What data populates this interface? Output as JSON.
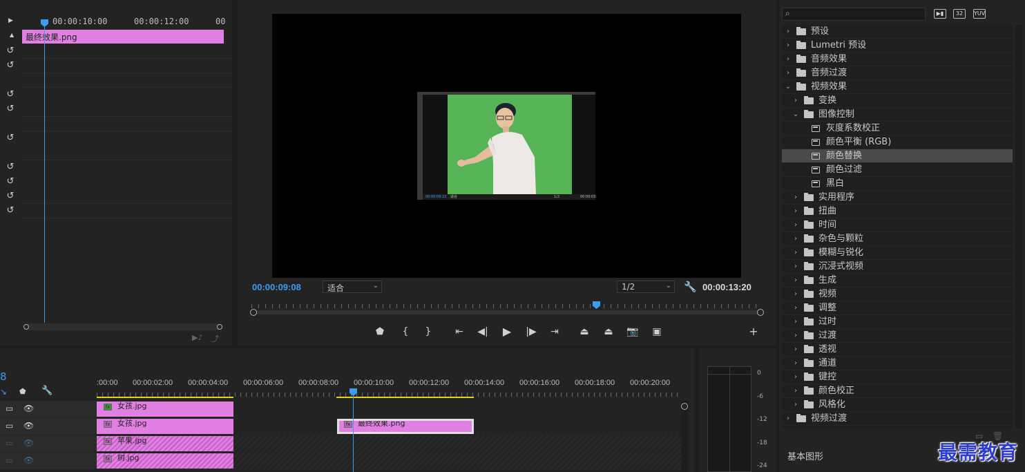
{
  "effect_controls": {
    "ruler_ticks": [
      "00:00:10:00",
      "00:00:12:00",
      "00"
    ],
    "clip_name": "最终效果.png",
    "reset_icon": "reset-icon"
  },
  "program_monitor": {
    "current_timecode": "00:00:09:08",
    "fit_label": "适合",
    "resolution_label": "1/2",
    "duration_timecode": "00:00:13:20",
    "pip_timecode": "00:00:09:22",
    "pip_fit": "适合",
    "pip_res": "1/2",
    "pip_duration": "00:00:03:",
    "buttons": [
      "add-marker",
      "mark-in",
      "mark-out",
      "go-to-in",
      "step-back",
      "play",
      "step-forward",
      "go-to-out",
      "lift",
      "extract",
      "export-frame",
      "comparison-view",
      "add-button"
    ]
  },
  "effects_panel": {
    "search_placeholder": "",
    "badges": [
      "32",
      "YUV"
    ],
    "items": [
      {
        "label": "预设",
        "level": 0,
        "type": "folder",
        "open": false
      },
      {
        "label": "Lumetri 预设",
        "level": 0,
        "type": "folder",
        "open": false
      },
      {
        "label": "音频效果",
        "level": 0,
        "type": "folder",
        "open": false
      },
      {
        "label": "音频过渡",
        "level": 0,
        "type": "folder",
        "open": false
      },
      {
        "label": "视频效果",
        "level": 0,
        "type": "folder",
        "open": true
      },
      {
        "label": "变换",
        "level": 1,
        "type": "folder",
        "open": false
      },
      {
        "label": "图像控制",
        "level": 1,
        "type": "folder",
        "open": true
      },
      {
        "label": "灰度系数校正",
        "level": 2,
        "type": "effect"
      },
      {
        "label": "颜色平衡 (RGB)",
        "level": 2,
        "type": "effect"
      },
      {
        "label": "颜色替换",
        "level": 2,
        "type": "effect",
        "selected": true
      },
      {
        "label": "颜色过滤",
        "level": 2,
        "type": "effect"
      },
      {
        "label": "黑白",
        "level": 2,
        "type": "effect"
      },
      {
        "label": "实用程序",
        "level": 1,
        "type": "folder",
        "open": false
      },
      {
        "label": "扭曲",
        "level": 1,
        "type": "folder",
        "open": false
      },
      {
        "label": "时间",
        "level": 1,
        "type": "folder",
        "open": false
      },
      {
        "label": "杂色与颗粒",
        "level": 1,
        "type": "folder",
        "open": false
      },
      {
        "label": "模糊与锐化",
        "level": 1,
        "type": "folder",
        "open": false
      },
      {
        "label": "沉浸式视频",
        "level": 1,
        "type": "folder",
        "open": false
      },
      {
        "label": "生成",
        "level": 1,
        "type": "folder",
        "open": false
      },
      {
        "label": "视频",
        "level": 1,
        "type": "folder",
        "open": false
      },
      {
        "label": "调整",
        "level": 1,
        "type": "folder",
        "open": false
      },
      {
        "label": "过时",
        "level": 1,
        "type": "folder",
        "open": false
      },
      {
        "label": "过渡",
        "level": 1,
        "type": "folder",
        "open": false
      },
      {
        "label": "透视",
        "level": 1,
        "type": "folder",
        "open": false
      },
      {
        "label": "通道",
        "level": 1,
        "type": "folder",
        "open": false
      },
      {
        "label": "键控",
        "level": 1,
        "type": "folder",
        "open": false
      },
      {
        "label": "颜色校正",
        "level": 1,
        "type": "folder",
        "open": false
      },
      {
        "label": "风格化",
        "level": 1,
        "type": "folder",
        "open": false
      },
      {
        "label": "视频过渡",
        "level": 0,
        "type": "folder",
        "open": false
      }
    ],
    "essential_graphics": "基本图形",
    "watermark": "最需教育"
  },
  "timeline": {
    "timecode_fragment": "8",
    "ruler_ticks": [
      ":00:00",
      "00:00:02:00",
      "00:00:04:00",
      "00:00:06:00",
      "00:00:08:00",
      "00:00:10:00",
      "00:00:12:00",
      "00:00:14:00",
      "00:00:16:00",
      "00:00:18:00",
      "00:00:20:00"
    ],
    "tracks": [
      {
        "clips": [
          {
            "name": "女孩.jpg",
            "hatched": false,
            "green": true
          }
        ]
      },
      {
        "clips": [
          {
            "name": "女孩.jpg",
            "hatched": false
          },
          {
            "name": "最终效果.png",
            "hatched": false,
            "outlined": true
          }
        ]
      },
      {
        "clips": [
          {
            "name": "苹果.jpg",
            "hatched": true
          }
        ]
      },
      {
        "clips": [
          {
            "name": "树.jpg",
            "hatched": true
          }
        ]
      }
    ]
  },
  "audio_meter": {
    "db_labels": [
      "0",
      "-6",
      "-12",
      "-18",
      "-24"
    ]
  }
}
